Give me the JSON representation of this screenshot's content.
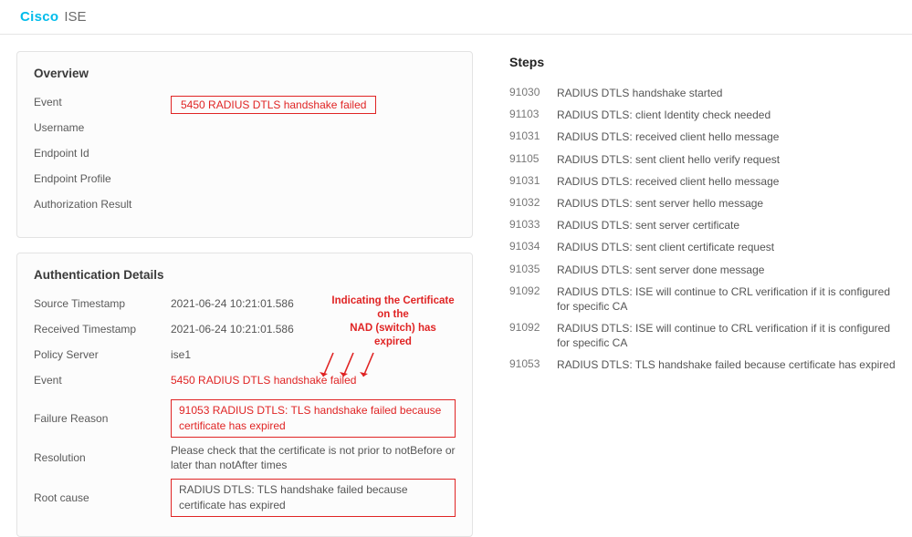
{
  "header": {
    "brand1": "Cisco",
    "brand2": "ISE"
  },
  "overview": {
    "title": "Overview",
    "rows": {
      "event_label": "Event",
      "event_value": "5450 RADIUS DTLS handshake failed",
      "username_label": "Username",
      "endpoint_id_label": "Endpoint Id",
      "endpoint_profile_label": "Endpoint Profile",
      "authz_result_label": "Authorization Result"
    }
  },
  "auth": {
    "title": "Authentication Details",
    "source_ts_label": "Source Timestamp",
    "source_ts_value": "2021-06-24 10:21:01.586",
    "received_ts_label": "Received Timestamp",
    "received_ts_value": "2021-06-24 10:21:01.586",
    "policy_server_label": "Policy Server",
    "policy_server_value": "ise1",
    "event_label": "Event",
    "event_value": "5450 RADIUS DTLS handshake failed",
    "failure_reason_label": "Failure Reason",
    "failure_reason_value": "91053 RADIUS DTLS: TLS handshake failed because certificate has expired",
    "resolution_label": "Resolution",
    "resolution_value": "Please check that the certificate is not prior to notBefore or later than notAfter times",
    "root_cause_label": "Root cause",
    "root_cause_value": "RADIUS DTLS: TLS handshake failed because certificate has expired",
    "annotation_line1": "Indicating the Certificate on the",
    "annotation_line2": "NAD (switch) has expired"
  },
  "steps": {
    "title": "Steps",
    "list": [
      {
        "code": "91030",
        "desc": "RADIUS DTLS handshake started"
      },
      {
        "code": "91103",
        "desc": "RADIUS DTLS: client Identity check needed"
      },
      {
        "code": "91031",
        "desc": "RADIUS DTLS: received client hello message"
      },
      {
        "code": "91105",
        "desc": "RADIUS DTLS: sent client hello verify request"
      },
      {
        "code": "91031",
        "desc": "RADIUS DTLS: received client hello message"
      },
      {
        "code": "91032",
        "desc": "RADIUS DTLS: sent server hello message"
      },
      {
        "code": "91033",
        "desc": "RADIUS DTLS: sent server certificate"
      },
      {
        "code": "91034",
        "desc": "RADIUS DTLS: sent client certificate request"
      },
      {
        "code": "91035",
        "desc": "RADIUS DTLS: sent server done message"
      },
      {
        "code": "91092",
        "desc": "RADIUS DTLS: ISE will continue to CRL verification if it is configured for specific CA"
      },
      {
        "code": "91092",
        "desc": "RADIUS DTLS: ISE will continue to CRL verification if it is configured for specific CA"
      },
      {
        "code": "91053",
        "desc": "RADIUS DTLS: TLS handshake failed because certificate has expired"
      }
    ]
  }
}
